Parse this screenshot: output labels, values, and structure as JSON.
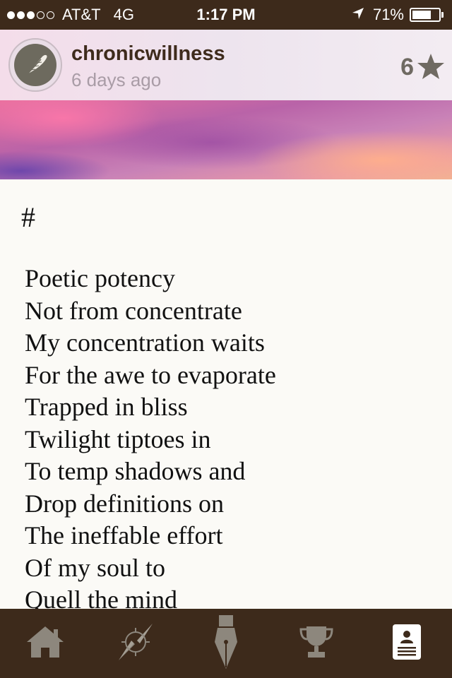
{
  "status_bar": {
    "carrier": "AT&T",
    "network": "4G",
    "time": "1:17 PM",
    "battery_percent": "71%",
    "battery_level": 0.71,
    "signal_bars_filled": 3,
    "signal_bars_total": 5
  },
  "post": {
    "username": "chronicwillness",
    "time_ago": "6 days ago",
    "star_count": "6",
    "avatar_icon": "quill-feather-icon",
    "star_icon": "star-icon"
  },
  "poem": {
    "title": "#",
    "lines": [
      "Poetic potency",
      "Not from concentrate",
      "My concentration waits",
      "For the awe to evaporate",
      "Trapped in bliss",
      "Twilight tiptoes in",
      "To temp shadows and",
      "Drop definitions on",
      "The ineffable effort",
      "Of my soul to",
      "Quell the mind"
    ]
  },
  "tab_bar": {
    "tabs": [
      {
        "icon": "home-icon"
      },
      {
        "icon": "compass-icon"
      },
      {
        "icon": "pen-nib-icon"
      },
      {
        "icon": "trophy-icon"
      },
      {
        "icon": "profile-card-icon"
      }
    ]
  },
  "colors": {
    "bar_brown": "#3d2a1b",
    "paper": "#fbfaf6",
    "icon_gray": "#8d877d"
  }
}
